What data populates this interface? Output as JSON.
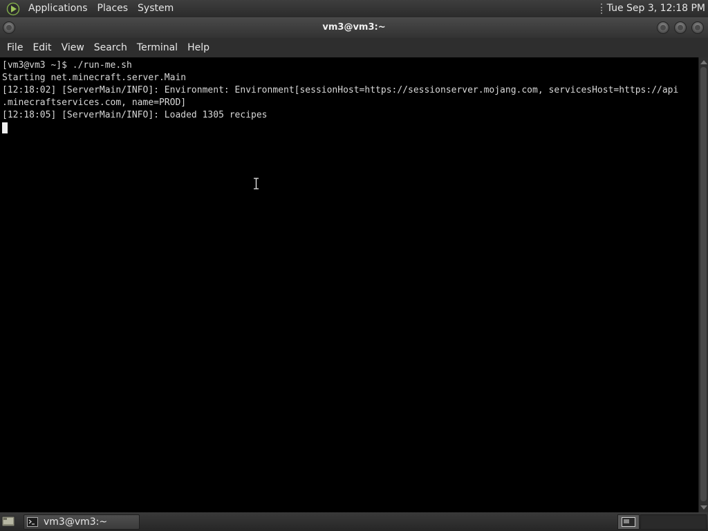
{
  "top_panel": {
    "menus": [
      "Applications",
      "Places",
      "System"
    ],
    "clock": "Tue Sep  3, 12:18 PM"
  },
  "window": {
    "title": "vm3@vm3:~"
  },
  "menubar": {
    "items": [
      "File",
      "Edit",
      "View",
      "Search",
      "Terminal",
      "Help"
    ]
  },
  "terminal": {
    "lines": [
      "[vm3@vm3 ~]$ ./run-me.sh",
      "Starting net.minecraft.server.Main",
      "[12:18:02] [ServerMain/INFO]: Environment: Environment[sessionHost=https://sessionserver.mojang.com, servicesHost=https://api",
      ".minecraftservices.com, name=PROD]",
      "[12:18:05] [ServerMain/INFO]: Loaded 1305 recipes"
    ]
  },
  "bottom_panel": {
    "task_label": "vm3@vm3:~"
  },
  "icons": {
    "app_logo": "gnome-foot-icon",
    "show_desktop": "show-desktop-icon",
    "task": "terminal-icon",
    "workspace": "workspace-switcher-icon"
  },
  "colors": {
    "terminal_bg": "#000000",
    "terminal_fg": "#d8d8d8",
    "panel_bg": "#333333"
  }
}
